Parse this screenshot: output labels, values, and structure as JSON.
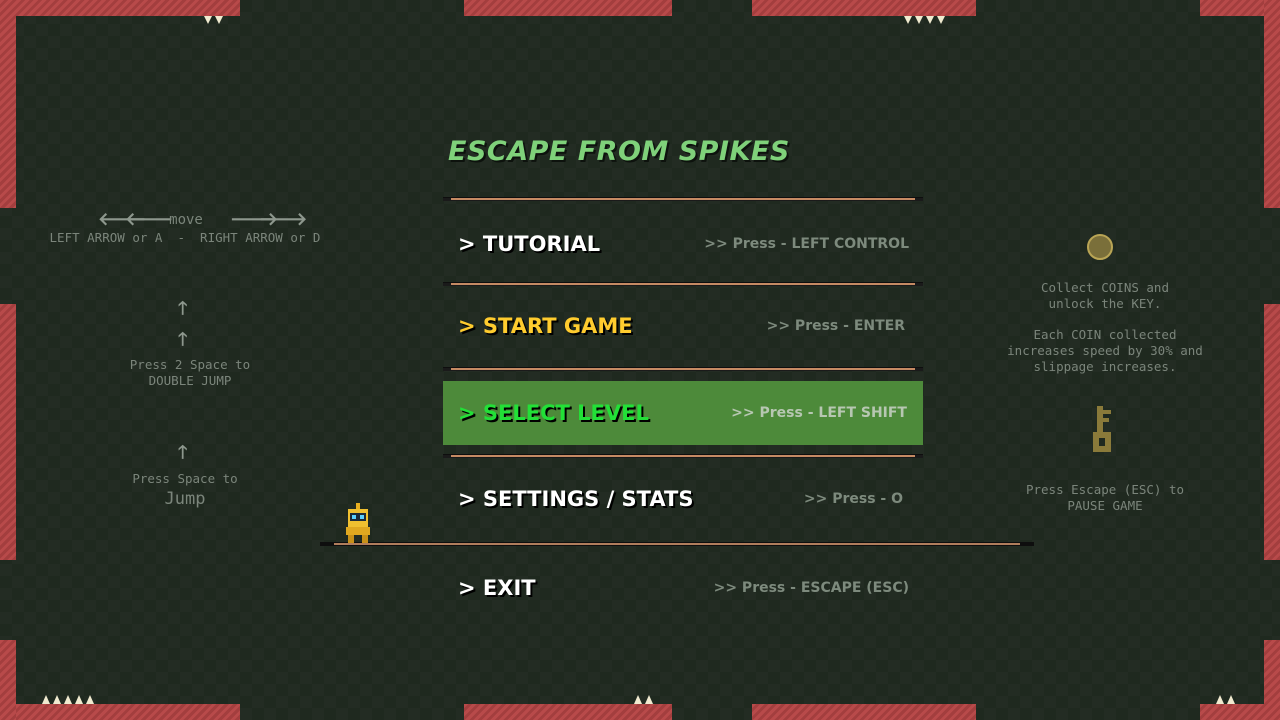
{
  "title": "ESCAPE FROM SPIKES",
  "menu": [
    {
      "label": "> TUTORIAL",
      "hint": ">> Press - LEFT CONTROL"
    },
    {
      "label": "> START GAME",
      "hint": ">> Press - ENTER"
    },
    {
      "label": "> SELECT LEVEL",
      "hint": ">> Press - LEFT SHIFT"
    },
    {
      "label": "> SETTINGS / STATS",
      "hint": ">> Press - O"
    },
    {
      "label": "> EXIT",
      "hint": ">> Press - ESCAPE (ESC)"
    }
  ],
  "controls": {
    "move_label": "move",
    "move_keys": "LEFT ARROW or A  -  RIGHT ARROW or D",
    "double_jump_line1": "Press 2 Space to",
    "double_jump_line2": "DOUBLE JUMP",
    "jump_line1": "Press Space to",
    "jump_line2": "Jump"
  },
  "info": {
    "coin_line1": "Collect COINS and",
    "coin_line2": "unlock the KEY.",
    "speed_line1": "Each COIN collected",
    "speed_line2": "increases speed by 30% and",
    "speed_line3": "slippage increases.",
    "pause_line1": "Press Escape (ESC) to",
    "pause_line2": "PAUSE GAME"
  },
  "colors": {
    "background": "#1f291f",
    "wall": "#b84a4a",
    "title": "#7fd17a",
    "selected_bg": "#4d8a3a",
    "selected_text": "#22e037",
    "start_text": "#ffcc2e"
  },
  "icons": [
    "arrow-left-icon",
    "arrow-right-icon",
    "arrow-up-icon",
    "coin-icon",
    "key-icon",
    "player-robot-icon",
    "spike-icon"
  ]
}
